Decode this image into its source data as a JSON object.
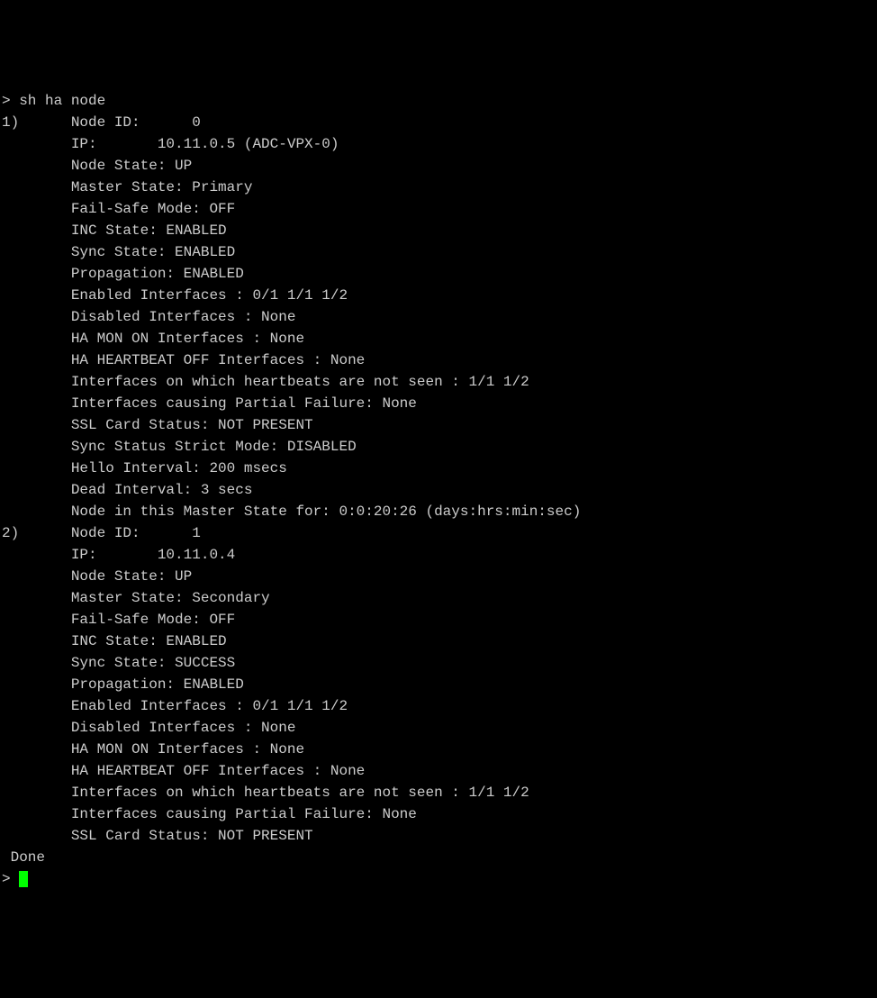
{
  "prompt_symbol": ">",
  "command": "sh ha node",
  "nodes": [
    {
      "index": "1)",
      "lines": [
        "Node ID:      0",
        "IP:       10.11.0.5 (ADC-VPX-0)",
        "Node State: UP",
        "Master State: Primary",
        "Fail-Safe Mode: OFF",
        "INC State: ENABLED",
        "Sync State: ENABLED",
        "Propagation: ENABLED",
        "Enabled Interfaces : 0/1 1/1 1/2",
        "Disabled Interfaces : None",
        "HA MON ON Interfaces : None",
        "HA HEARTBEAT OFF Interfaces : None",
        "Interfaces on which heartbeats are not seen : 1/1 1/2",
        "Interfaces causing Partial Failure: None",
        "SSL Card Status: NOT PRESENT",
        "Sync Status Strict Mode: DISABLED",
        "Hello Interval: 200 msecs",
        "Dead Interval: 3 secs",
        "Node in this Master State for: 0:0:20:26 (days:hrs:min:sec)"
      ]
    },
    {
      "index": "2)",
      "lines": [
        "Node ID:      1",
        "IP:       10.11.0.4",
        "Node State: UP",
        "Master State: Secondary",
        "Fail-Safe Mode: OFF",
        "INC State: ENABLED",
        "Sync State: SUCCESS",
        "Propagation: ENABLED",
        "Enabled Interfaces : 0/1 1/1 1/2",
        "Disabled Interfaces : None",
        "HA MON ON Interfaces : None",
        "HA HEARTBEAT OFF Interfaces : None",
        "Interfaces on which heartbeats are not seen : 1/1 1/2",
        "Interfaces causing Partial Failure: None",
        "SSL Card Status: NOT PRESENT"
      ]
    }
  ],
  "done_text": " Done",
  "final_prompt": "> "
}
